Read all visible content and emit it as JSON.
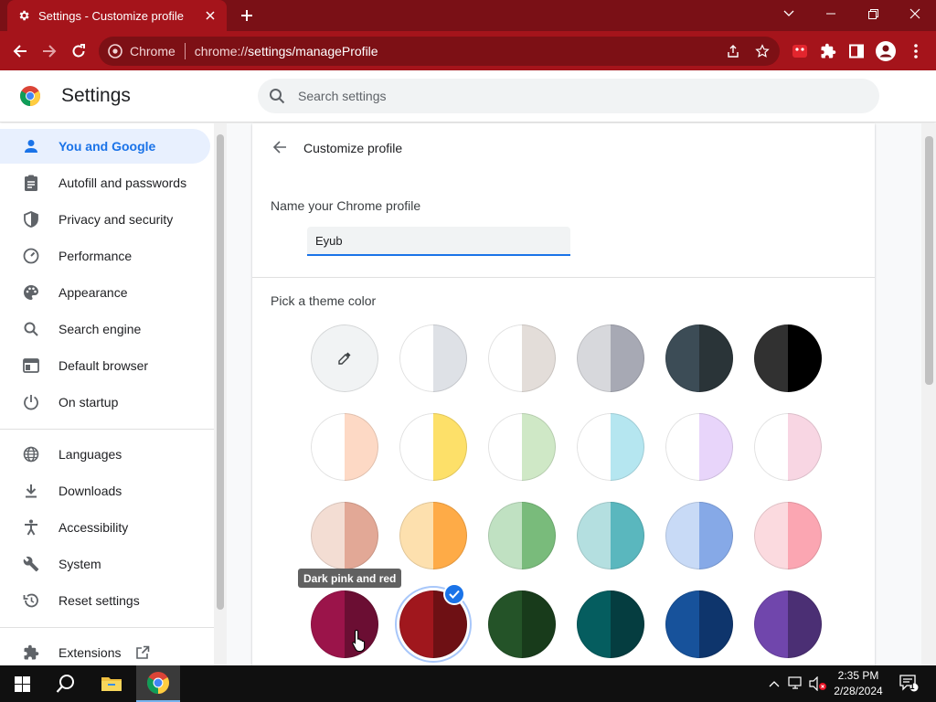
{
  "browser": {
    "tab_title": "Settings - Customize profile",
    "omnibox_site": "Chrome",
    "url_prefix": "chrome://",
    "url_rest": "settings/manageProfile"
  },
  "settings": {
    "title": "Settings",
    "search_placeholder": "Search settings"
  },
  "sidebar": {
    "items": [
      {
        "label": "You and Google",
        "icon": "person-icon",
        "active": true
      },
      {
        "label": "Autofill and passwords",
        "icon": "clipboard-icon"
      },
      {
        "label": "Privacy and security",
        "icon": "shield-icon"
      },
      {
        "label": "Performance",
        "icon": "speedometer-icon"
      },
      {
        "label": "Appearance",
        "icon": "palette-icon"
      },
      {
        "label": "Search engine",
        "icon": "search-icon"
      },
      {
        "label": "Default browser",
        "icon": "browser-window-icon"
      },
      {
        "label": "On startup",
        "icon": "power-icon"
      },
      {
        "label": "Languages",
        "icon": "globe-icon"
      },
      {
        "label": "Downloads",
        "icon": "download-icon"
      },
      {
        "label": "Accessibility",
        "icon": "accessibility-icon"
      },
      {
        "label": "System",
        "icon": "wrench-icon"
      },
      {
        "label": "Reset settings",
        "icon": "history-icon"
      },
      {
        "label": "Extensions",
        "icon": "puzzle-icon"
      }
    ]
  },
  "profile": {
    "page_title": "Customize profile",
    "name_heading": "Name your Chrome profile",
    "name_value": "Eyub",
    "theme_heading": "Pick a theme color",
    "tooltip": "Dark pink and red",
    "swatches": [
      [
        "#f1f3f4",
        "#f1f3f4"
      ],
      [
        "#ffffff",
        "#dee1e6"
      ],
      [
        "#ffffff",
        "#e3ddd9"
      ],
      [
        "#d7d8dc",
        "#a7a9b4"
      ],
      [
        "#3c4c56",
        "#2a3438"
      ],
      [
        "#313131",
        "#000000"
      ],
      [
        "#ffffff",
        "#fdd9c5"
      ],
      [
        "#ffffff",
        "#fde069"
      ],
      [
        "#ffffff",
        "#cfe8c6"
      ],
      [
        "#ffffff",
        "#b5e6f0"
      ],
      [
        "#ffffff",
        "#e8d5fa"
      ],
      [
        "#ffffff",
        "#f8d6e3"
      ],
      [
        "#f3ddd3",
        "#e2a896"
      ],
      [
        "#fde0ae",
        "#feab47"
      ],
      [
        "#c0e1c2",
        "#79bb7b"
      ],
      [
        "#b4dfe0",
        "#5ab7be"
      ],
      [
        "#c8daf6",
        "#86a9e7"
      ],
      [
        "#fbdadf",
        "#fba6b2"
      ],
      [
        "#9b144a",
        "#6b0e33"
      ],
      [
        "#a0171d",
        "#6e1014"
      ],
      [
        "#245328",
        "#183b1b"
      ],
      [
        "#055d5f",
        "#053d40"
      ],
      [
        "#17529b",
        "#0e356c"
      ],
      [
        "#7046ac",
        "#4b2f74"
      ]
    ],
    "selected_index": 19
  },
  "taskbar": {
    "time": "2:35 PM",
    "date": "2/28/2024",
    "notification_count": "1"
  }
}
